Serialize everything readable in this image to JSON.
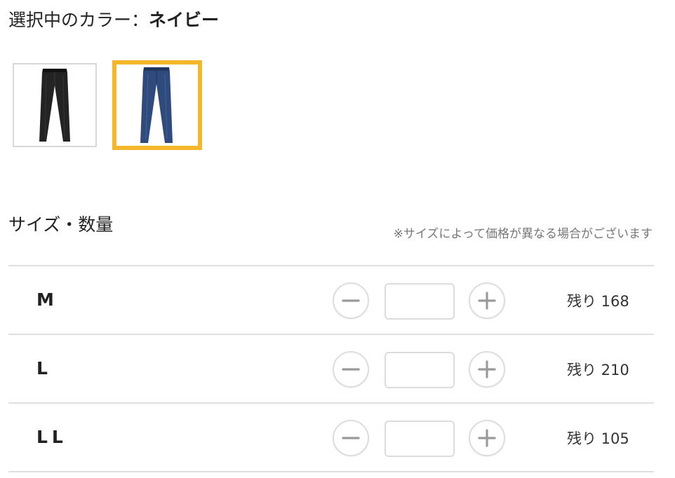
{
  "color_selector": {
    "heading_label": "選択中のカラー：",
    "selected_color": "ネイビー",
    "accent_color": "#f5b72a",
    "swatches": [
      {
        "name": "black",
        "color": "#232323",
        "selected": false
      },
      {
        "name": "navy",
        "color": "#2f4a7c",
        "selected": true
      }
    ]
  },
  "size_section": {
    "heading": "サイズ・数量",
    "note": "※サイズによって価格が異なる場合がございます",
    "rows": [
      {
        "size": "M",
        "quantity": "",
        "stock": "残り 168"
      },
      {
        "size": "L",
        "quantity": "",
        "stock": "残り 210"
      },
      {
        "size": "LL",
        "quantity": "",
        "stock": "残り 105"
      }
    ]
  }
}
